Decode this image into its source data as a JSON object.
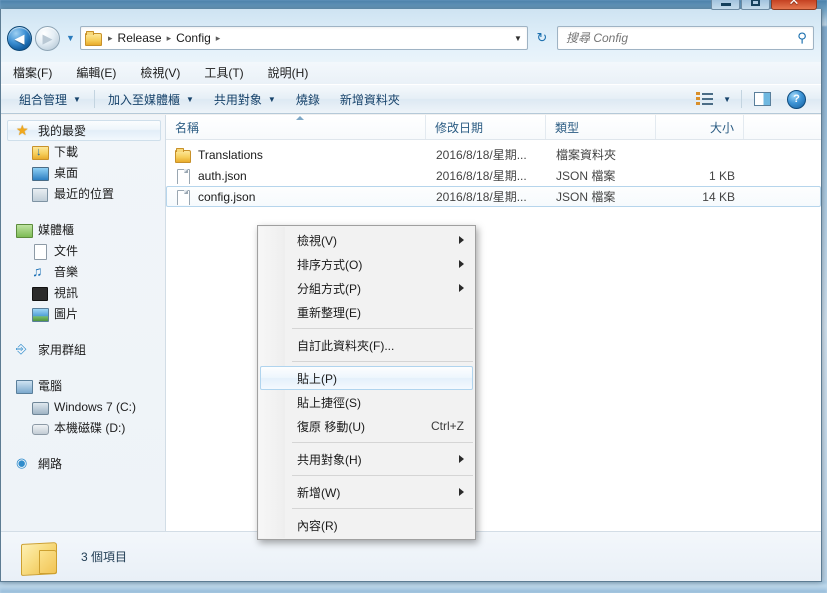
{
  "window": {
    "caption_buttons": [
      {
        "name": "minimize",
        "glyph": "minimize-icon"
      },
      {
        "name": "maximize",
        "glyph": "maximize-icon"
      },
      {
        "name": "close",
        "glyph": "✕"
      }
    ]
  },
  "navbar": {
    "back_arrow": "◀",
    "forward_arrow": "▶",
    "recent_pages_caret": "▼",
    "breadcrumb": {
      "folder_icon": "folder-icon",
      "separator": "▸",
      "items": [
        "Release",
        "Config"
      ]
    },
    "breadcrumb_dropdown_caret": "▼",
    "refresh_glyph": "↻"
  },
  "search": {
    "placeholder": "搜尋 Config",
    "value": "",
    "icon": "search-icon"
  },
  "menubar": {
    "items": [
      {
        "label": "檔案(F)"
      },
      {
        "label": "編輯(E)"
      },
      {
        "label": "檢視(V)"
      },
      {
        "label": "工具(T)"
      },
      {
        "label": "說明(H)"
      }
    ]
  },
  "toolbar": {
    "items": [
      {
        "label": "組合管理",
        "caret": "▼"
      },
      {
        "label": "加入至媒體櫃",
        "caret": "▼"
      },
      {
        "label": "共用對象",
        "caret": "▼"
      },
      {
        "label": "燒錄",
        "caret": ""
      },
      {
        "label": "新增資料夾",
        "caret": ""
      }
    ],
    "view_caret": "▼",
    "help_glyph": "?"
  },
  "sidebar": {
    "groups": [
      {
        "header": {
          "label": "我的最愛",
          "icon": "star-icon",
          "selected": true
        },
        "children": [
          {
            "label": "下載",
            "icon": "downloads-folder-icon"
          },
          {
            "label": "桌面",
            "icon": "desktop-icon"
          },
          {
            "label": "最近的位置",
            "icon": "recent-places-icon"
          }
        ]
      },
      {
        "header": {
          "label": "媒體櫃",
          "icon": "libraries-icon",
          "selected": false
        },
        "children": [
          {
            "label": "文件",
            "icon": "documents-icon"
          },
          {
            "label": "音樂",
            "icon": "music-icon"
          },
          {
            "label": "視訊",
            "icon": "videos-icon"
          },
          {
            "label": "圖片",
            "icon": "pictures-icon"
          }
        ]
      },
      {
        "header": {
          "label": "家用群組",
          "icon": "homegroup-icon",
          "selected": false
        },
        "children": []
      },
      {
        "header": {
          "label": "電腦",
          "icon": "computer-icon",
          "selected": false
        },
        "children": [
          {
            "label": "Windows 7 (C:)",
            "icon": "os-drive-icon"
          },
          {
            "label": "本機磁碟 (D:)",
            "icon": "local-disk-icon"
          }
        ]
      },
      {
        "header": {
          "label": "網路",
          "icon": "network-icon",
          "selected": false
        },
        "children": []
      }
    ]
  },
  "file_list": {
    "columns": [
      {
        "key": "name",
        "label": "名稱",
        "sorted": true,
        "sort_dir": "asc"
      },
      {
        "key": "date",
        "label": "修改日期",
        "sorted": false
      },
      {
        "key": "type",
        "label": "類型",
        "sorted": false
      },
      {
        "key": "size",
        "label": "大小",
        "sorted": false
      }
    ],
    "rows": [
      {
        "name": "Translations",
        "date": "2016/8/18/星期...",
        "type": "檔案資料夾",
        "size": "",
        "icon": "folder-icon",
        "focused": false
      },
      {
        "name": "auth.json",
        "date": "2016/8/18/星期...",
        "type": "JSON 檔案",
        "size": "1 KB",
        "icon": "file-icon",
        "focused": false
      },
      {
        "name": "config.json",
        "date": "2016/8/18/星期...",
        "type": "JSON 檔案",
        "size": "14 KB",
        "icon": "file-icon",
        "focused": true
      }
    ]
  },
  "context_menu": {
    "items": [
      {
        "label": "檢視(V)",
        "accel": "",
        "submenu": true,
        "highlighted": false,
        "separator_after": false
      },
      {
        "label": "排序方式(O)",
        "accel": "",
        "submenu": true,
        "highlighted": false,
        "separator_after": false
      },
      {
        "label": "分組方式(P)",
        "accel": "",
        "submenu": true,
        "highlighted": false,
        "separator_after": false
      },
      {
        "label": "重新整理(E)",
        "accel": "",
        "submenu": false,
        "highlighted": false,
        "separator_after": true
      },
      {
        "label": "自訂此資料夾(F)...",
        "accel": "",
        "submenu": false,
        "highlighted": false,
        "separator_after": true
      },
      {
        "label": "貼上(P)",
        "accel": "",
        "submenu": false,
        "highlighted": true,
        "separator_after": false
      },
      {
        "label": "貼上捷徑(S)",
        "accel": "",
        "submenu": false,
        "highlighted": false,
        "separator_after": false
      },
      {
        "label": "復原 移動(U)",
        "accel": "Ctrl+Z",
        "submenu": false,
        "highlighted": false,
        "separator_after": true
      },
      {
        "label": "共用對象(H)",
        "accel": "",
        "submenu": true,
        "highlighted": false,
        "separator_after": true
      },
      {
        "label": "新增(W)",
        "accel": "",
        "submenu": true,
        "highlighted": false,
        "separator_after": true
      },
      {
        "label": "內容(R)",
        "accel": "",
        "submenu": false,
        "highlighted": false,
        "separator_after": false
      }
    ]
  },
  "status_bar": {
    "icon": "folder-icon",
    "text": "3 個項目"
  },
  "colors": {
    "accent": "#2a7bbd",
    "folder_yellow": "#f6cf5c",
    "close_red": "#c13b1c",
    "selection_blue": "#b0d4ee"
  }
}
